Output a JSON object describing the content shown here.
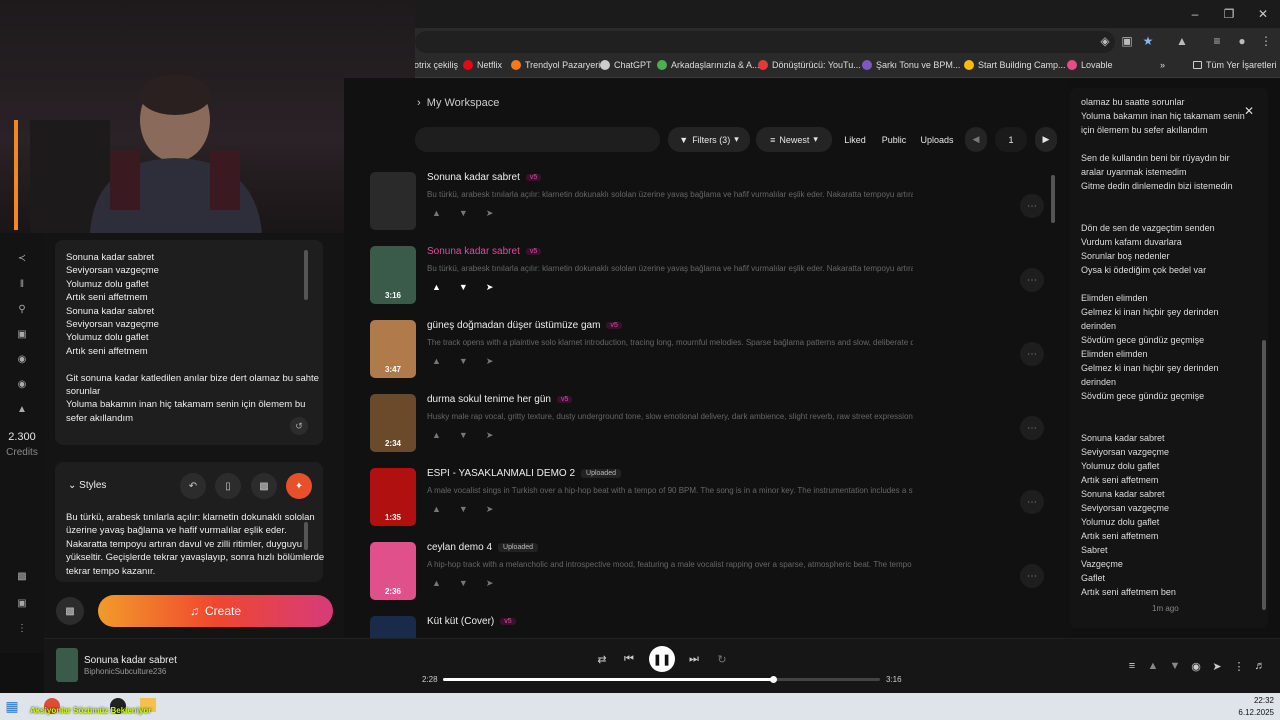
{
  "browser": {
    "bookmarks": [
      {
        "label": "otrix çekiliş",
        "color": "#888888"
      },
      {
        "label": "Netflix",
        "color": "#e50914"
      },
      {
        "label": "Trendyol Pazaryeri",
        "color": "#f27a1a"
      },
      {
        "label": "ChatGPT",
        "color": "#cccccc"
      },
      {
        "label": "Arkadaşlarınızla & A...",
        "color": "#4caf50"
      },
      {
        "label": "Dönüştürücü: YouTu...",
        "color": "#e53935"
      },
      {
        "label": "Şarkı Tonu ve BPM...",
        "color": "#7e57c2"
      },
      {
        "label": "Start Building Camp...",
        "color": "#fbbc05"
      },
      {
        "label": "Lovable",
        "color": "#e94b8a"
      }
    ],
    "all_bookmarks": "Tüm Yer İşaretleri",
    "more": "»"
  },
  "sidebar": {
    "credits_value": "2.300",
    "credits_label": "Credits"
  },
  "left_panel": {
    "lyrics_lines": [
      "Sonuna kadar sabret",
      "Seviyorsan vazgeçme",
      "Yolumuz dolu gaflet",
      "Artık seni affetmem",
      "Sonuna kadar sabret",
      "Seviyorsan vazgeçme",
      "Yolumuz dolu gaflet",
      "Artık seni affetmem",
      "",
      "Git sonuna kadar katledilen anılar bize dert olamaz bu sahte",
      "sorunlar",
      "Yoluma bakamın inan hiç takamam senin için ölemem bu",
      "sefer akıllandım"
    ],
    "styles_label": "Styles",
    "styles_text": [
      "Bu türkü, arabesk tınılarla açılır: klarnetin dokunaklı sololan",
      "üzerine yavaş bağlama ve hafif vurmalılar eşlik eder.",
      "Nakaratta tempoyu artıran davul ve zilli ritimler, duyguyu",
      "yükseltir. Geçişlerde tekrar yavaşlayıp, sonra hızlı bölümlerde",
      "tekrar tempo kazanır."
    ],
    "create_label": "Create"
  },
  "workspace": {
    "breadcrumb": "My Workspace",
    "filters_label": "Filters (3)",
    "sort_label": "Newest",
    "tabs": [
      "Liked",
      "Public",
      "Uploads"
    ],
    "page": "1"
  },
  "songs": [
    {
      "title": "Sonuna kadar sabret",
      "version": "v5",
      "uploaded": "",
      "duration": "",
      "desc": "Bu türkü, arabesk tınılarla açılır: klarnetin dokunaklı sololan üzerine yavaş bağlama ve hafif vurmalılar eşlik eder. Nakaratta tempoyu artıran davul",
      "active": false,
      "thumb": "#2a2a2a"
    },
    {
      "title": "Sonuna kadar sabret",
      "version": "v5",
      "uploaded": "",
      "duration": "3:16",
      "desc": "Bu türkü, arabesk tınılarla açılır: klarnetin dokunaklı sololan üzerine yavaş bağlama ve hafif vurmalılar eşlik eder. Nakaratta tempoyu artıran davul",
      "active": true,
      "thumb": "#3a5a4a"
    },
    {
      "title": "güneş doğmadan düşer üstümüze gam",
      "version": "v5",
      "uploaded": "",
      "duration": "3:47",
      "desc": "The track opens with a plaintive solo klarnet introduction, tracing long, mournful melodies. Sparse bağlama patterns and slow, deliberate darbu",
      "active": false,
      "thumb": "#b07a4a"
    },
    {
      "title": "durma sokul tenime her gün",
      "version": "v5",
      "uploaded": "",
      "duration": "2:34",
      "desc": "Husky male rap vocal, gritty texture, dusty underground tone, slow emotional delivery, dark ambience, slight reverb, raw street expression. Deep",
      "active": false,
      "thumb": "#6a4a2a"
    },
    {
      "title": "ESPI - YASAKLANMALI DEMO 2",
      "version": "",
      "uploaded": "Uploaded",
      "duration": "1:35",
      "desc": "A male vocalist sings in Turkish over a hip-hop beat with a tempo of 90 BPM. The song is in a minor key. The instrumentation includes a synth b",
      "active": false,
      "thumb": "#b01010"
    },
    {
      "title": "ceylan demo 4",
      "version": "",
      "uploaded": "Uploaded",
      "duration": "2:36",
      "desc": "A hip-hop track with a melancholic and introspective mood, featuring a male vocalist rapping over a sparse, atmospheric beat. The tempo is slo",
      "active": false,
      "thumb": "#e0508a"
    },
    {
      "title": "Küt küt (Cover)",
      "version": "v5",
      "uploaded": "",
      "duration": "",
      "desc": "",
      "active": false,
      "thumb": "#1a2a4a"
    }
  ],
  "lyrics_panel": {
    "lines": [
      "olamaz bu saatte sorunlar",
      "Yoluma bakamın inan hiç takamam senin",
      "için ölemem bu sefer akıllandım",
      "",
      "Sen de kullandın beni bir rüyaydın bir",
      "aralar uyanmak istemedim",
      "Gitme dedin dinlemedin bizi istemedin",
      "",
      "",
      "Dön de sen de vazgeçtim senden",
      "Vurdum kafamı duvarlara",
      "Sorunlar boş nedenler",
      "Oysa ki ödediğim çok bedel var",
      "",
      "Elimden elimden",
      "Gelmez ki inan hiçbir şey derinden",
      "derinden",
      "Sövdüm gece gündüz geçmişe",
      "Elimden elimden",
      "Gelmez ki inan hiçbir şey derinden",
      "derinden",
      "Sövdüm gece gündüz geçmişe",
      "",
      "",
      "Sonuna kadar sabret",
      "Seviyorsan vazgeçme",
      "Yolumuz dolu gaflet",
      "Artık seni affetmem",
      "Sonuna kadar sabret",
      "Seviyorsan vazgeçme",
      "Yolumuz dolu gaflet",
      "Artık seni affetmem",
      "Sabret",
      "Vazgeçme",
      "Gaflet",
      "Artık seni affetmem ben"
    ],
    "timestamp": "1m ago"
  },
  "player": {
    "title": "Sonuna kadar sabret",
    "artist": "BiphonicSubculture236",
    "elapsed": "2:28",
    "total": "3:16",
    "progress": 0.755
  },
  "taskbar": {
    "time": "22:32",
    "date": "6.12.2025",
    "caption": "Aksiyonlar Sözümüz Bekleniyor"
  }
}
